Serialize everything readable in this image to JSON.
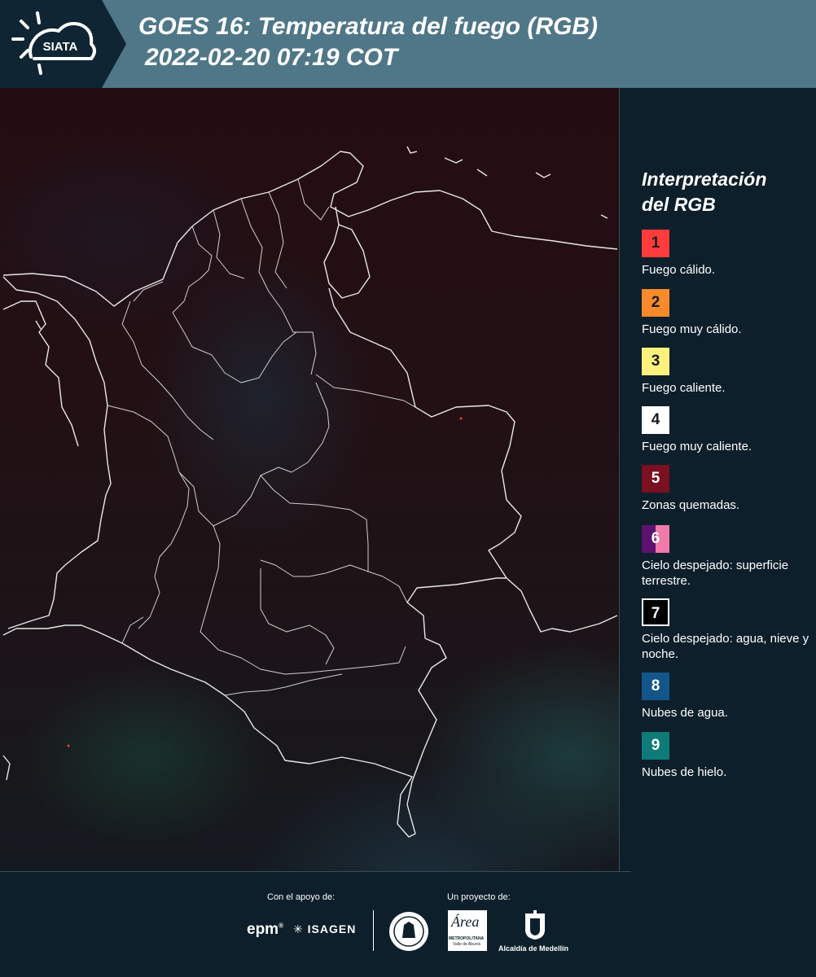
{
  "header": {
    "logo_text": "SIATA",
    "title_line1": "GOES 16: Temperatura del fuego (RGB)",
    "title_line2": "2022-02-20 07:19 COT",
    "background_color": "#4f7788",
    "logo_background_color": "#0f2533"
  },
  "legend": {
    "title_line1": "Interpretación",
    "title_line2": "del RGB",
    "items": [
      {
        "number": "1",
        "label": "Fuego cálido.",
        "color": "#ff3b3b",
        "text_color": "#1a1a1a"
      },
      {
        "number": "2",
        "label": "Fuego muy cálido.",
        "color": "#f78a2a",
        "text_color": "#1a1a1a"
      },
      {
        "number": "3",
        "label": "Fuego caliente.",
        "color": "#fdf17e",
        "text_color": "#1a1a1a"
      },
      {
        "number": "4",
        "label": "Fuego muy caliente.",
        "color": "#ffffff",
        "text_color": "#1a1a1a"
      },
      {
        "number": "5",
        "label": "Zonas quemadas.",
        "color": "#7a1020",
        "text_color": "#ffffff"
      },
      {
        "number": "6",
        "label": "Cielo despejado: superficie terrestre.",
        "color": "#5e1270",
        "color2": "#f07aa8",
        "text_color": "#ffffff"
      },
      {
        "number": "7",
        "label": "Cielo despejado: agua, nieve y noche.",
        "color": "#000000",
        "text_color": "#ffffff"
      },
      {
        "number": "8",
        "label": "Nubes de agua.",
        "color": "#13578a",
        "text_color": "#ffffff"
      },
      {
        "number": "9",
        "label": "Nubes de hielo.",
        "color": "#0f7b78",
        "text_color": "#ffffff"
      }
    ]
  },
  "footer": {
    "support_label": "Con el apoyo de:",
    "project_label": "Un proyecto de:",
    "sponsor_epm": "epm",
    "sponsor_isagen": "ISAGEN",
    "area_logo_text": "Área",
    "area_caption_line1": "METROPOLITANA",
    "area_caption_line2": "Valle de Aburrá",
    "medellin_caption": "Alcaldía de Medellín"
  }
}
